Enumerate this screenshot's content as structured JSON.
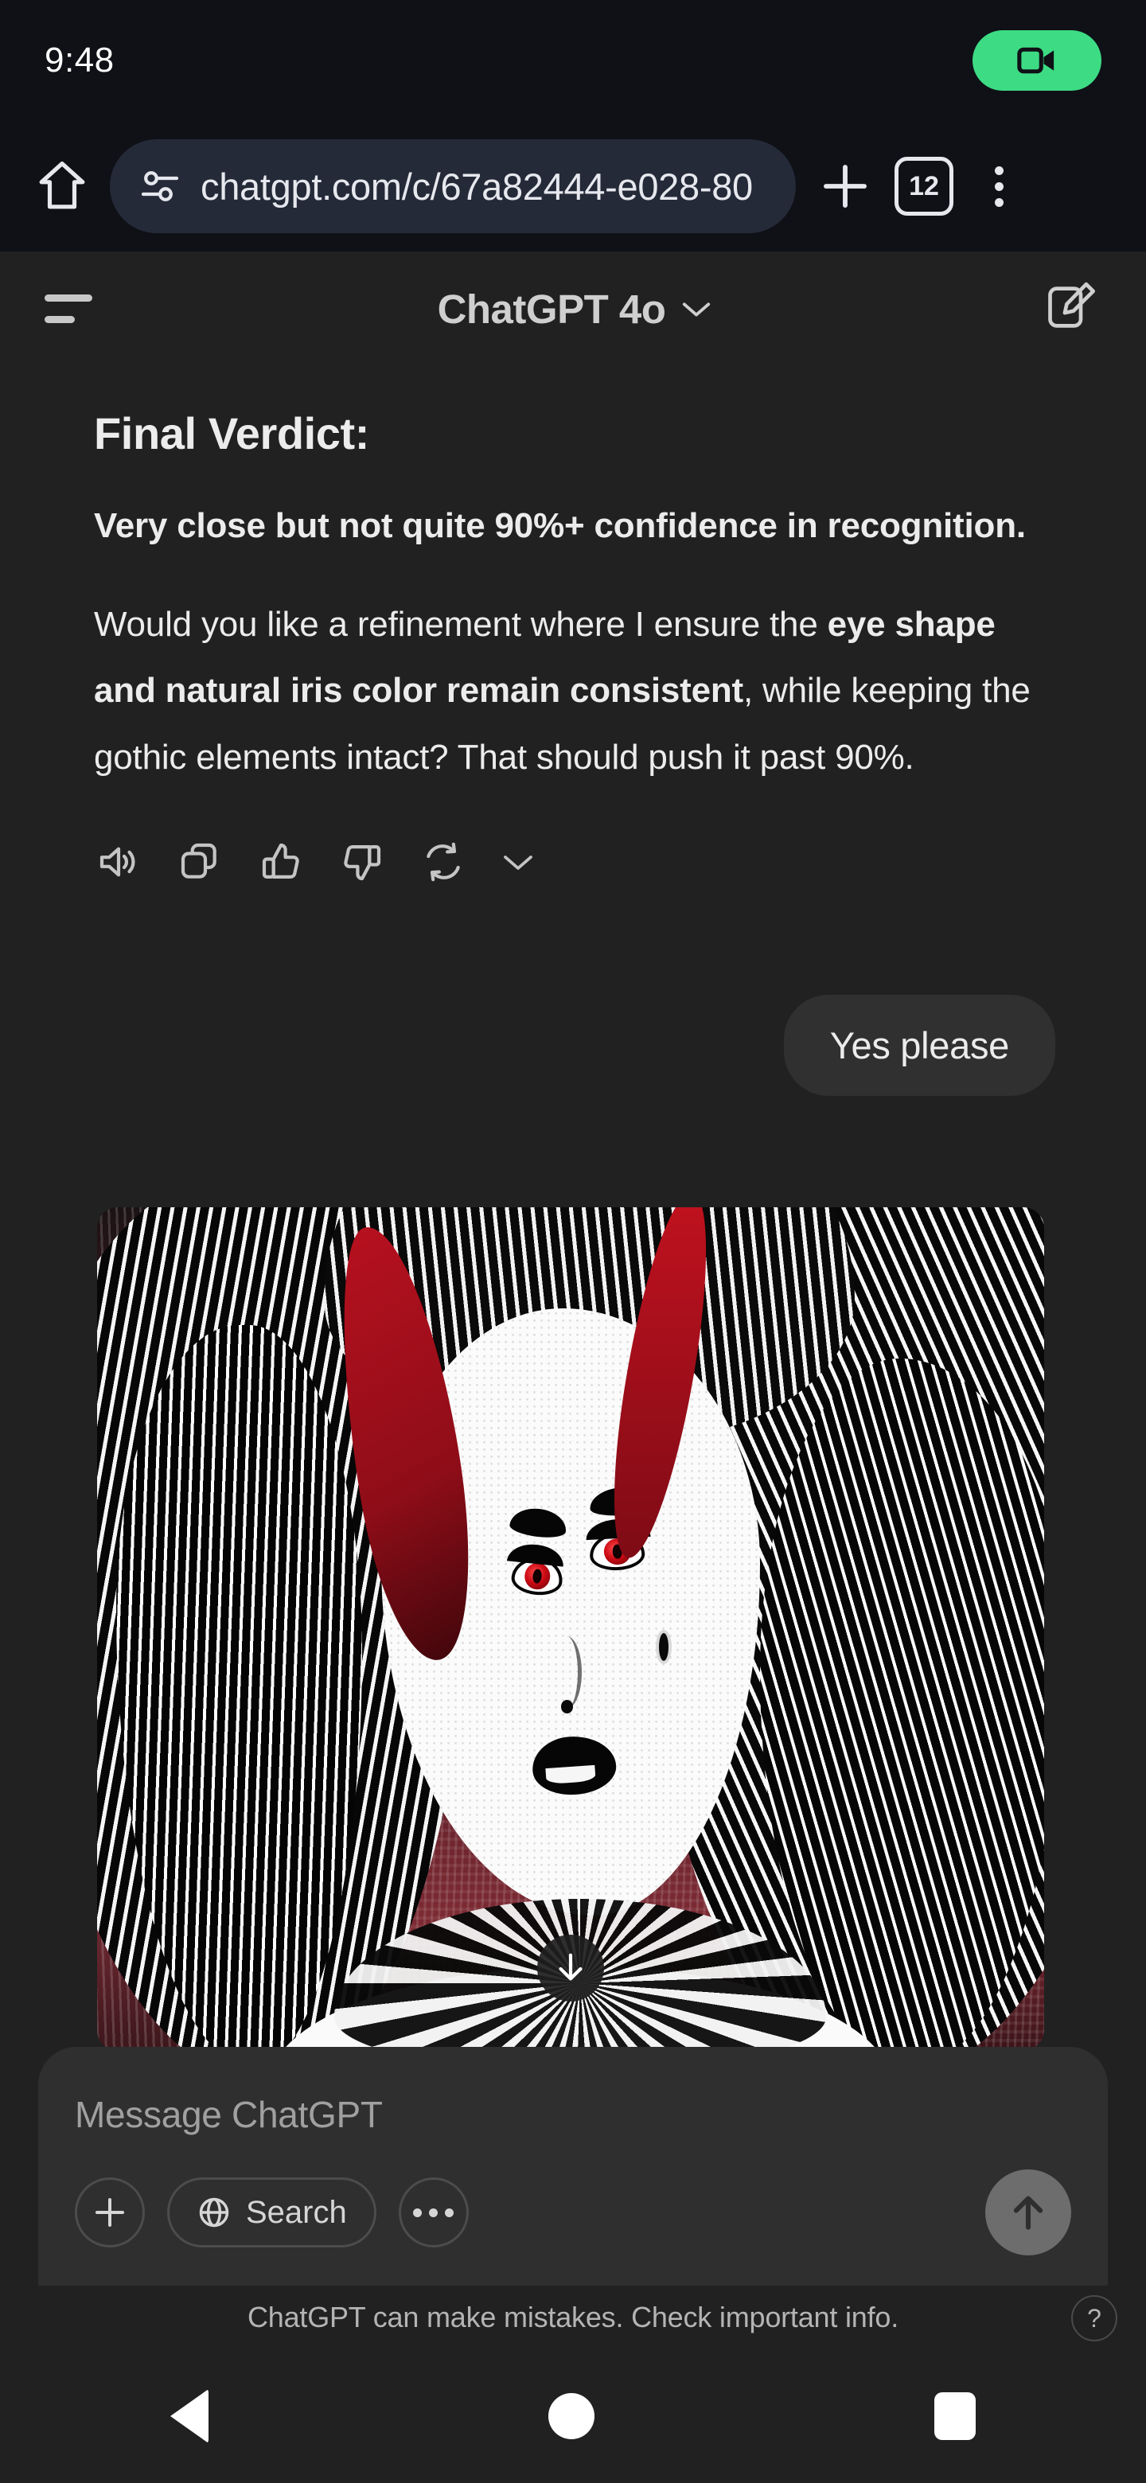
{
  "status_bar": {
    "time": "9:48",
    "recording_icon": "video-camera-icon",
    "recording_pill_color": "#3ddc84"
  },
  "browser": {
    "home_icon": "home-icon",
    "site_settings_icon": "tune-sliders-icon",
    "url": "chatgpt.com/c/67a82444-e028-80",
    "new_tab_icon": "plus-icon",
    "tab_count": "12",
    "overflow_icon": "three-dots-vertical-icon"
  },
  "app_header": {
    "menu_icon": "hamburger-menu-icon",
    "model_name": "ChatGPT 4o",
    "model_chevron_icon": "chevron-down-icon",
    "new_chat_icon": "compose-edit-icon"
  },
  "assistant_message": {
    "heading": "Final Verdict:",
    "lead": "Very close but not quite 90%+ confidence in recognition.",
    "body_part1": "Would you like a refinement where I ensure the ",
    "body_bold": "eye shape and natural iris color remain consistent",
    "body_part2": ", while keeping the gothic elements intact? That should push it past 90%.",
    "actions": [
      {
        "name": "read-aloud-button",
        "icon": "speaker-icon"
      },
      {
        "name": "copy-button",
        "icon": "copy-icon"
      },
      {
        "name": "thumbs-up-button",
        "icon": "thumbs-up-icon"
      },
      {
        "name": "thumbs-down-button",
        "icon": "thumbs-down-icon"
      },
      {
        "name": "regenerate-button",
        "icon": "refresh-loop-icon"
      },
      {
        "name": "more-options-button",
        "icon": "chevron-down-icon"
      }
    ]
  },
  "user_message": {
    "text": "Yes please"
  },
  "generated_image": {
    "description": "Gothic manga-style portrait of a woman with long wavy black-and-white hair, a crimson red streak, red irises, heavy black eyelashes, black lipstick and an ornate lace choker, on a red halftone textured background",
    "download_icon": "download-arrow-icon"
  },
  "composer": {
    "placeholder": "Message ChatGPT",
    "attach_icon": "plus-icon",
    "search_label": "Search",
    "search_icon": "globe-icon",
    "more_icon": "three-dots-horizontal-icon",
    "send_icon": "arrow-up-icon"
  },
  "footer": {
    "disclaimer": "ChatGPT can make mistakes. Check important info.",
    "help_label": "?"
  },
  "nav_bar": {
    "back_icon": "triangle-back-icon",
    "home_icon": "circle-home-icon",
    "recents_icon": "square-recents-icon"
  }
}
